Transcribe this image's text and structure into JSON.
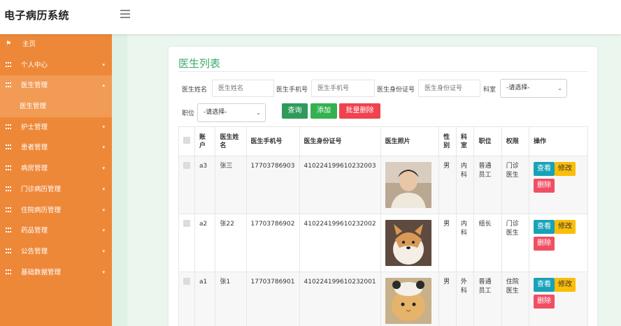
{
  "app": {
    "title": "电子病历系统"
  },
  "sidebar": {
    "items": [
      {
        "label": "主页",
        "icon": "flag-icon"
      },
      {
        "label": "个人中心",
        "icon": "grid-icon",
        "caret": "▾"
      },
      {
        "label": "医生管理",
        "icon": "grid-icon",
        "caret": "▴"
      },
      {
        "label": "医生管理",
        "sub": true
      },
      {
        "label": "护士管理",
        "icon": "grid-icon",
        "caret": "▾"
      },
      {
        "label": "患者管理",
        "icon": "grid-icon",
        "caret": "▾"
      },
      {
        "label": "病房管理",
        "icon": "grid-icon",
        "caret": "▾"
      },
      {
        "label": "门诊病历管理",
        "icon": "grid-icon",
        "caret": "▾"
      },
      {
        "label": "住院病历管理",
        "icon": "grid-icon",
        "caret": "▾"
      },
      {
        "label": "药品管理",
        "icon": "grid-icon",
        "caret": "▾"
      },
      {
        "label": "公告管理",
        "icon": "grid-icon",
        "caret": "▾"
      },
      {
        "label": "基础数据管理",
        "icon": "grid-icon",
        "caret": "▾"
      }
    ]
  },
  "page": {
    "title": "医生列表",
    "filters": {
      "name_label": "医生姓名",
      "name_placeholder": "医生姓名",
      "phone_label": "医生手机号",
      "phone_placeholder": "医生手机号",
      "idcard_label": "医生身份证号",
      "idcard_placeholder": "医生身份证号",
      "dept_label": "科室",
      "dept_value": "-请选择-",
      "position_label": "职位",
      "position_value": "-请选择-"
    },
    "buttons": {
      "search": "查询",
      "add": "添加",
      "batch_delete": "批量删除"
    },
    "table": {
      "headers": [
        "账户",
        "医生姓名",
        "医生手机号",
        "医生身份证号",
        "医生照片",
        "性别",
        "科室",
        "职位",
        "权限",
        "操作"
      ],
      "actions": {
        "view": "查看",
        "edit": "修改",
        "delete": "删除"
      },
      "rows": [
        {
          "account": "a3",
          "name": "张三",
          "phone": "17703786903",
          "idcard": "410224199610232003",
          "gender": "男",
          "dept": "内科",
          "position": "普通员工",
          "role": "门诊医生"
        },
        {
          "account": "a2",
          "name": "张22",
          "phone": "17703786902",
          "idcard": "410224199610232002",
          "gender": "男",
          "dept": "内科",
          "position": "组长",
          "role": "门诊医生"
        },
        {
          "account": "a1",
          "name": "张1",
          "phone": "17703786901",
          "idcard": "410224199610232001",
          "gender": "男",
          "dept": "外科",
          "position": "普通员工",
          "role": "住院医生"
        }
      ]
    }
  },
  "colors": {
    "sidebar": "#ee8839",
    "accent": "#3aaa6a",
    "danger": "#f0434f"
  }
}
